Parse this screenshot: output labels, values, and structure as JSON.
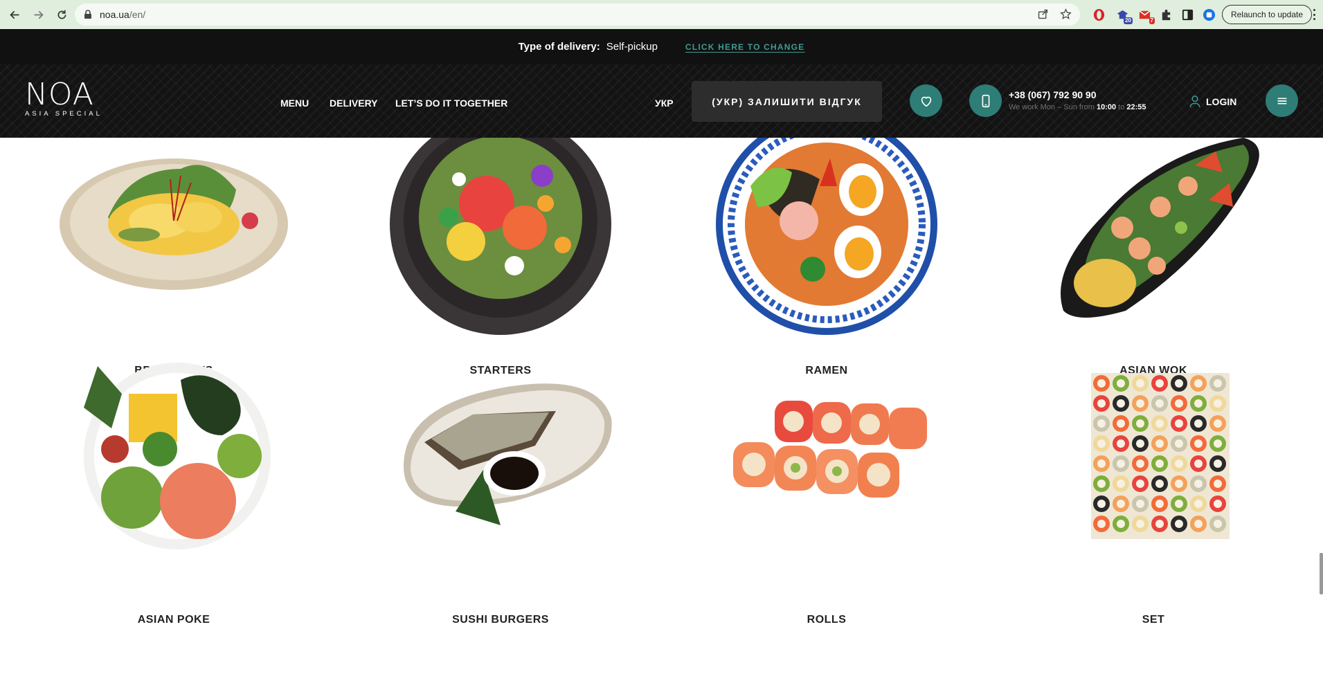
{
  "browser": {
    "url_host": "noa.ua",
    "url_path": "/en/",
    "relaunch_label": "Relaunch to update",
    "ext_badge_1": "20",
    "ext_badge_2": "7"
  },
  "delivery": {
    "label": "Type of delivery:",
    "value": "Self-pickup",
    "change_link": "CLICK HERE TO CHANGE"
  },
  "header": {
    "logo_main": "NOA",
    "logo_sub": "ASIA SPECIAL",
    "nav": [
      "MENU",
      "DELIVERY",
      "LET’S DO IT TOGETHER"
    ],
    "lang": "УКР",
    "review_button": "(УКР) ЗАЛИШИТИ ВІДГУК",
    "phone": "+38 (067) 792 90 90",
    "hours_prefix": "We work Mon – Sun from ",
    "hours_open": "10:00",
    "hours_mid": " to ",
    "hours_close": "22:55",
    "login": "LOGIN"
  },
  "categories": [
    {
      "name": "BREAKFASTS",
      "icon": "breakfast-plate"
    },
    {
      "name": "STARTERS",
      "icon": "salad-bowl"
    },
    {
      "name": "RAMEN",
      "icon": "ramen-bowl"
    },
    {
      "name": "ASIAN WOK",
      "icon": "wok-plate"
    },
    {
      "name": "ASIAN POKE",
      "icon": "poke-bowl"
    },
    {
      "name": "SUSHI BURGERS",
      "icon": "sushi-burger-plate"
    },
    {
      "name": "ROLLS",
      "icon": "rolls"
    },
    {
      "name": "SET",
      "icon": "sushi-set"
    }
  ],
  "colors": {
    "accent_teal": "#2e7d76",
    "link_teal": "#3f9b94",
    "header_bg": "#131313",
    "chrome_bg": "#dfeedd"
  }
}
